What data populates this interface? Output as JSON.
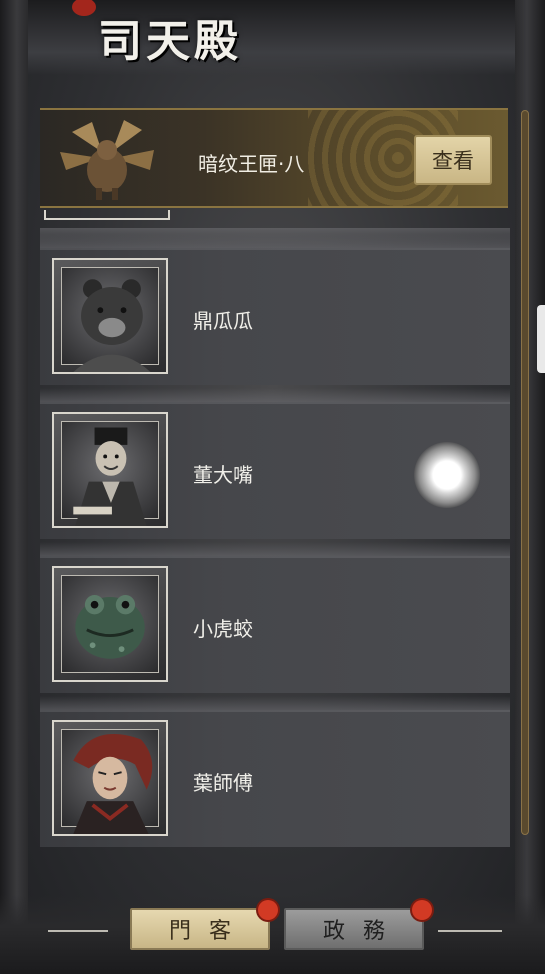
{
  "header": {
    "title": "司天殿"
  },
  "banner": {
    "item_name": "暗纹王匣·八",
    "view_button_label": "查看"
  },
  "characters": [
    {
      "name": "鼎瓜瓜",
      "portrait_icon": "bear-portrait-icon"
    },
    {
      "name": "董大嘴",
      "portrait_icon": "scholar-portrait-icon"
    },
    {
      "name": "小虎蛟",
      "portrait_icon": "toad-portrait-icon"
    },
    {
      "name": "葉師傅",
      "portrait_icon": "warrior-portrait-icon"
    }
  ],
  "tabs": [
    {
      "label": "門客",
      "active": true,
      "has_notification": true
    },
    {
      "label": "政務",
      "active": false,
      "has_notification": true
    }
  ],
  "colors": {
    "accent_gold": "#c9b685",
    "notification_red": "#d23a24"
  }
}
